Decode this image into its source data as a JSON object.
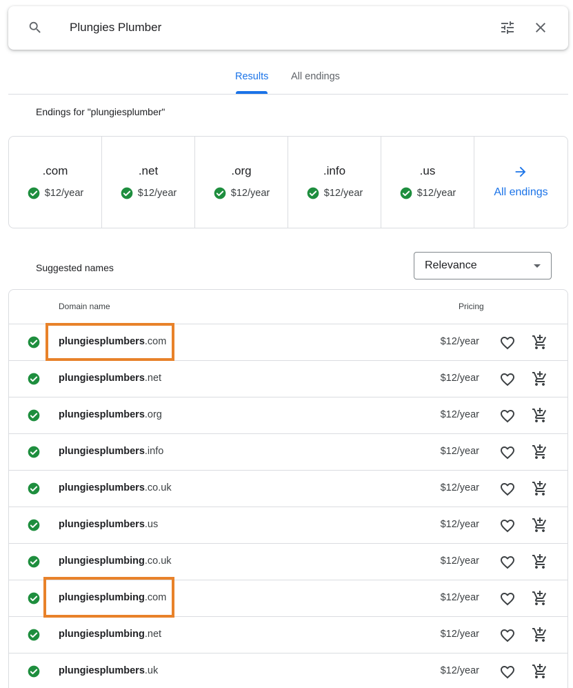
{
  "search": {
    "query": "Plungies Plumber"
  },
  "tabs": [
    {
      "label": "Results",
      "active": true
    },
    {
      "label": "All endings",
      "active": false
    }
  ],
  "endings_heading": "Endings for \"plungiesplumber\"",
  "endings": [
    {
      "name": ".com",
      "price": "$12/year"
    },
    {
      "name": ".net",
      "price": "$12/year"
    },
    {
      "name": ".org",
      "price": "$12/year"
    },
    {
      "name": ".info",
      "price": "$12/year"
    },
    {
      "name": ".us",
      "price": "$12/year"
    }
  ],
  "all_endings_label": "All endings",
  "suggested_heading": "Suggested names",
  "sort": {
    "selected": "Relevance"
  },
  "table": {
    "col_domain": "Domain name",
    "col_pricing": "Pricing",
    "rows": [
      {
        "base": "plungiesplumbers",
        "tld": ".com",
        "price": "$12/year"
      },
      {
        "base": "plungiesplumbers",
        "tld": ".net",
        "price": "$12/year"
      },
      {
        "base": "plungiesplumbers",
        "tld": ".org",
        "price": "$12/year"
      },
      {
        "base": "plungiesplumbers",
        "tld": ".info",
        "price": "$12/year"
      },
      {
        "base": "plungiesplumbers",
        "tld": ".co.uk",
        "price": "$12/year"
      },
      {
        "base": "plungiesplumbers",
        "tld": ".us",
        "price": "$12/year"
      },
      {
        "base": "plungiesplumbing",
        "tld": ".co.uk",
        "price": "$12/year"
      },
      {
        "base": "plungiesplumbing",
        "tld": ".com",
        "price": "$12/year"
      },
      {
        "base": "plungiesplumbing",
        "tld": ".net",
        "price": "$12/year"
      },
      {
        "base": "plungiesplumbers",
        "tld": ".uk",
        "price": "$12/year"
      }
    ]
  },
  "colors": {
    "accent": "#1a73e8",
    "available": "#1e8e3e",
    "highlight": "#e8822a"
  },
  "icons": [
    "search-icon",
    "filter-icon",
    "close-icon",
    "check-icon",
    "arrow-right-icon",
    "heart-icon",
    "add-to-cart-icon"
  ]
}
